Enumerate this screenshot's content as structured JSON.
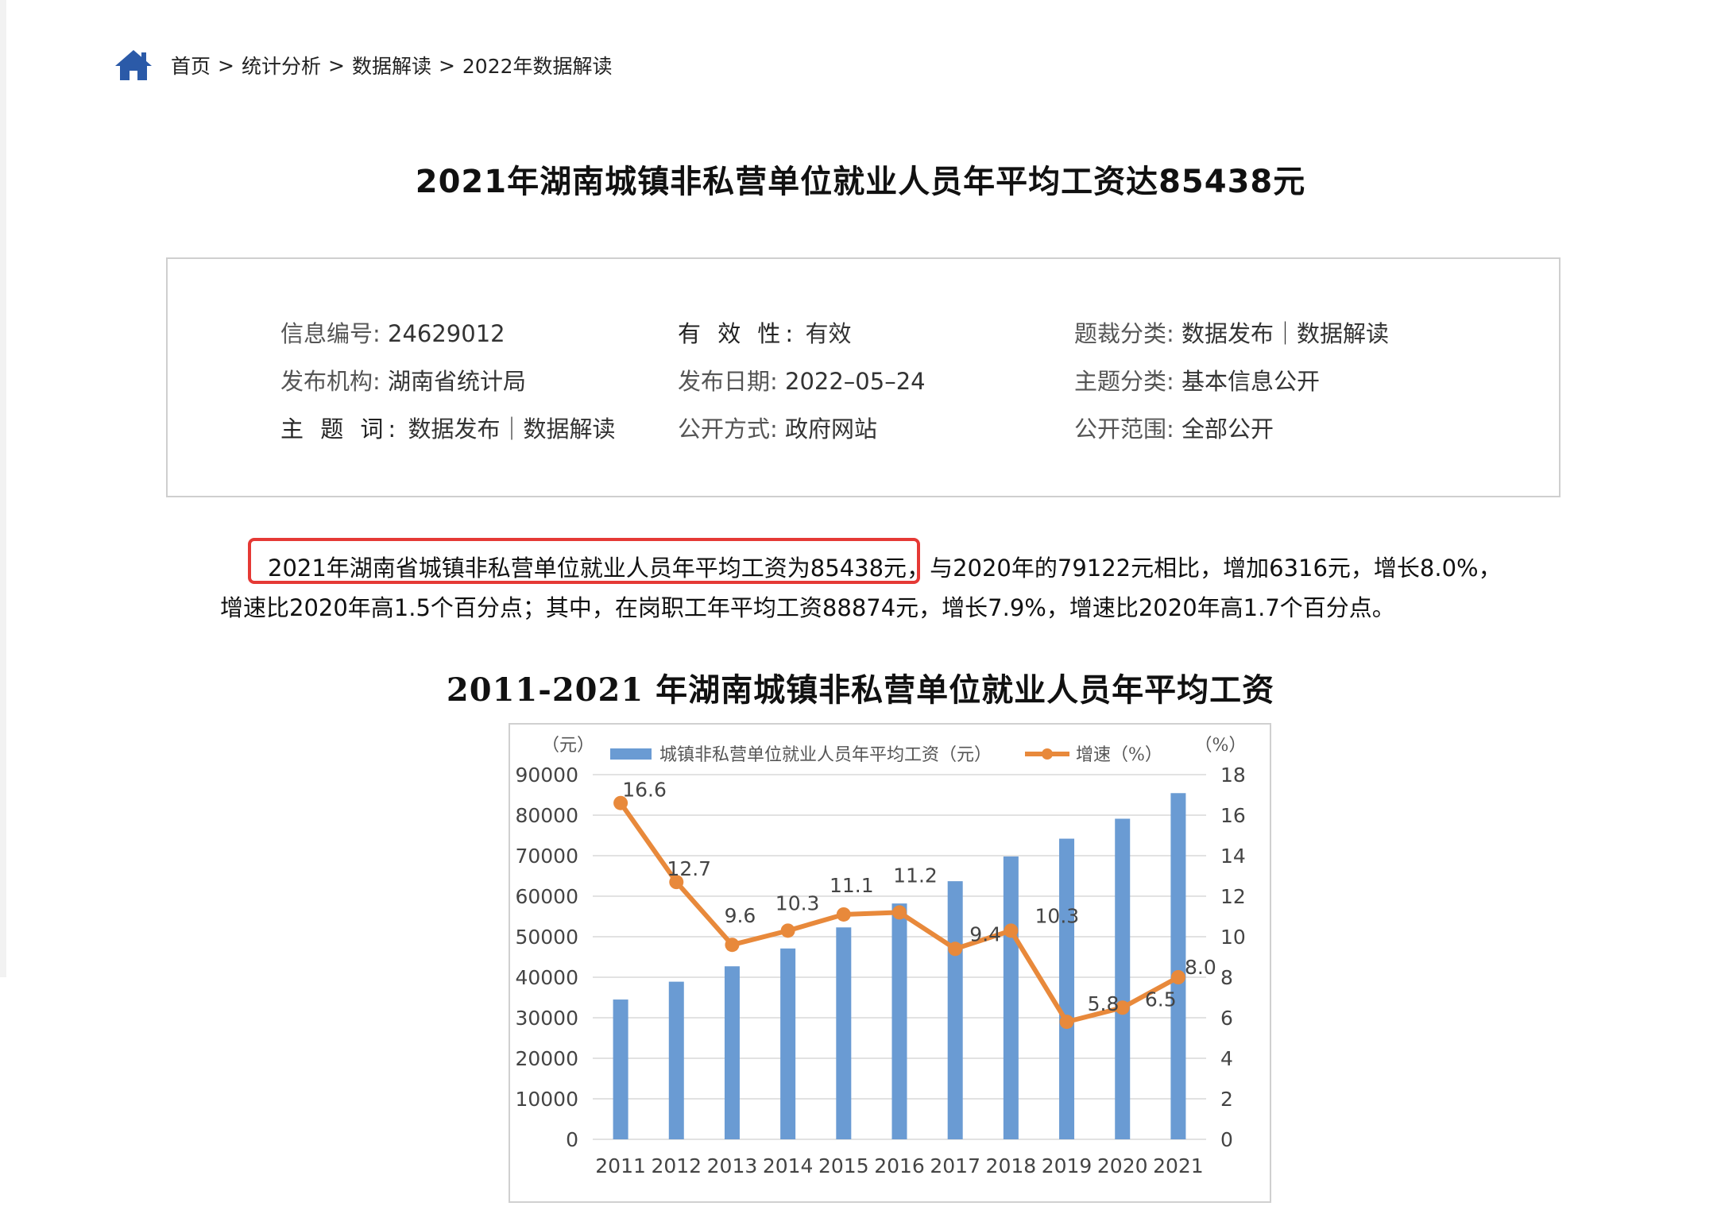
{
  "breadcrumb": {
    "home_icon": "home-icon",
    "items": [
      "首页",
      "统计分析",
      "数据解读",
      "2022年数据解读"
    ],
    "separator": ">"
  },
  "page_title": "2021年湖南城镇非私营单位就业人员年平均工资达85438元",
  "meta": {
    "info_no": {
      "label": "信息编号:",
      "value": "24629012"
    },
    "validity": {
      "label": "有 效 性:",
      "value": "有效"
    },
    "genre": {
      "label": "题裁分类:",
      "value": "数据发布｜数据解读"
    },
    "publisher": {
      "label": "发布机构:",
      "value": "湖南省统计局"
    },
    "publish_date": {
      "label": "发布日期:",
      "value": "2022–05–24"
    },
    "topic_class": {
      "label": "主题分类:",
      "value": "基本信息公开"
    },
    "keywords": {
      "label": "主 题 词:",
      "value": "数据发布｜数据解读"
    },
    "open_mode": {
      "label": "公开方式:",
      "value": "政府网站"
    },
    "open_scope": {
      "label": "公开范围:",
      "value": "全部公开"
    }
  },
  "body": {
    "highlight": "2021年湖南省城镇非私营单位就业人员年平均工资为85438元",
    "line1_rest": "，与2020年的79122元相比，增加6316元，增长8.0%，",
    "line2": "增速比2020年高1.5个百分点；其中，在岗职工年平均工资88874元，增长7.9%，增速比2020年高1.7个百分点。"
  },
  "colors": {
    "bar": "#6a9bd3",
    "line": "#e8893b",
    "highlight_border": "#e53935",
    "home_icon": "#2b5aa8"
  },
  "chart_data": {
    "type": "bar",
    "title": "2011-2021 年湖南城镇非私营单位就业人员年平均工资",
    "categories": [
      "2011",
      "2012",
      "2013",
      "2014",
      "2015",
      "2016",
      "2017",
      "2018",
      "2019",
      "2020",
      "2021"
    ],
    "series": [
      {
        "name": "城镇非私营单位就业人员年平均工资（元）",
        "type": "bar",
        "axis": "left",
        "values": [
          34500,
          38900,
          42700,
          47100,
          52300,
          58200,
          63700,
          69800,
          74200,
          79122,
          85438
        ]
      },
      {
        "name": "增速（%）",
        "type": "line",
        "axis": "right",
        "values": [
          16.6,
          12.7,
          9.6,
          10.3,
          11.1,
          11.2,
          9.4,
          10.3,
          5.8,
          6.5,
          8.0
        ],
        "labels": [
          "16.6",
          "12.7",
          "9.6",
          "10.3",
          "11.1",
          "11.2",
          "9.4",
          "10.3",
          "5.8",
          "6.5",
          "8.0"
        ]
      }
    ],
    "y_left": {
      "unit": "（元）",
      "range": [
        0,
        90000
      ],
      "ticks": [
        "0",
        "10000",
        "20000",
        "30000",
        "40000",
        "50000",
        "60000",
        "70000",
        "80000",
        "90000"
      ]
    },
    "y_right": {
      "unit": "（%）",
      "range": [
        0,
        18
      ],
      "ticks": [
        "0",
        "2",
        "4",
        "6",
        "8",
        "10",
        "12",
        "14",
        "16",
        "18"
      ]
    },
    "grid": true,
    "legend_position": "top"
  }
}
